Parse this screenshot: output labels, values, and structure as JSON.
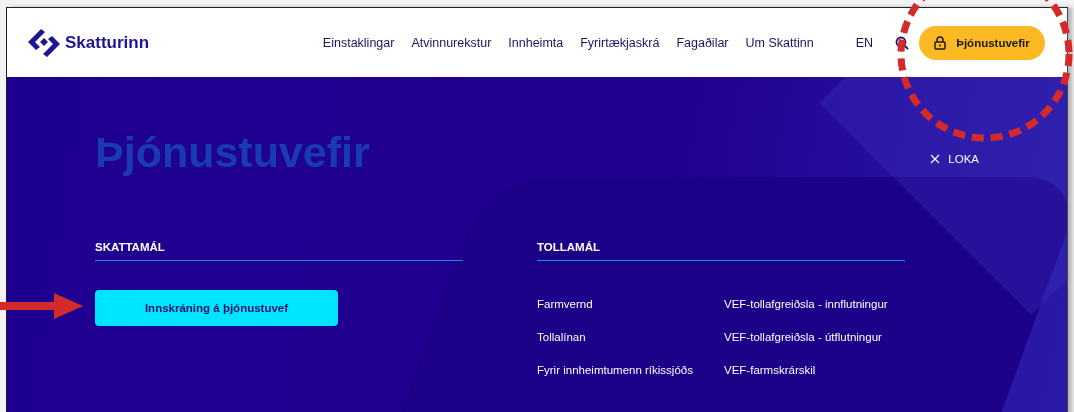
{
  "logo": {
    "text": "Skatturinn"
  },
  "nav": [
    "Einstaklingar",
    "Atvinnurekstur",
    "Innheimta",
    "Fyrirtækjaskrá",
    "Fagaðilar",
    "Um Skattinn"
  ],
  "language": "EN",
  "service_button": "Þjónustuvefir",
  "panel": {
    "title": "Þjónustuvefir",
    "close": "LOKA",
    "sections": [
      {
        "kind": "buttons",
        "heading": "SKATTAMÁL",
        "items": [
          "Innskráning á þjónustuvef"
        ]
      },
      {
        "kind": "links",
        "heading": "TOLLAMÁL",
        "columns": [
          [
            "Farmvernd",
            "Tollalínan",
            "Fyrir innheimtumenn ríkissjóðs"
          ],
          [
            "VEF-tollafgreiðsla - innflutningur",
            "VEF-tollafgreiðsla - útflutningur",
            "VEF-farmskrárskil"
          ]
        ]
      }
    ]
  }
}
